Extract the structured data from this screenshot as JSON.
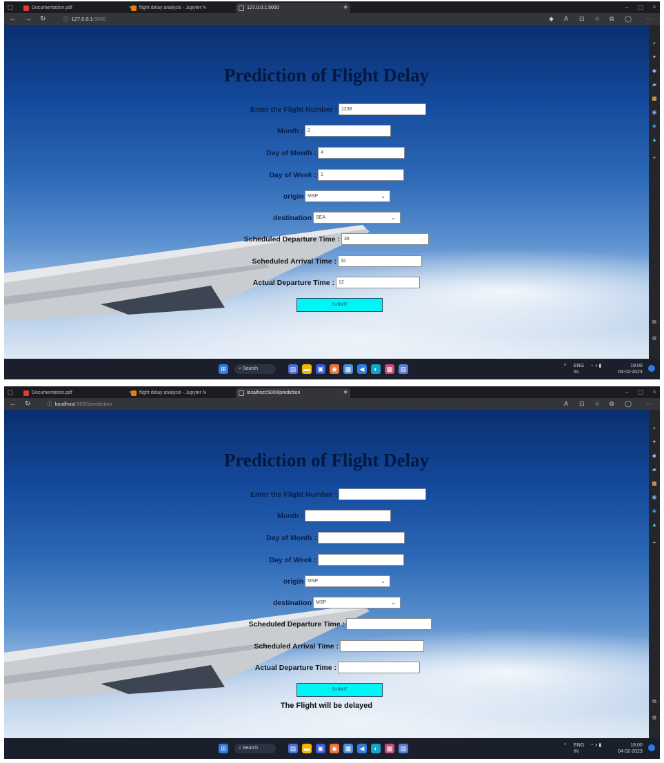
{
  "shot1": {
    "tabs": [
      {
        "title": "Documentation.pdf"
      },
      {
        "title": "flight delay analysis - Jupyter N"
      },
      {
        "title": "127.0.0.1:5000"
      }
    ],
    "url": {
      "host": "127.0.0.1",
      "path": ":5000"
    },
    "page": {
      "title": "Prediction of Flight Delay",
      "labels": {
        "flight_number": "Enter the Flight Number :",
        "month": "Month :",
        "day_of_month": "Day of Month :",
        "day_of_week": "Day of Week :",
        "origin": "origin",
        "destination": "destination",
        "sched_dep": "Scheduled Departure Time :",
        "sched_arr": "Scheduled Arrival Time :",
        "actual_dep": "Actual Departure Time :"
      },
      "values": {
        "flight_number": "1238",
        "month": "2",
        "day_of_month": "4",
        "day_of_week": "1",
        "origin": "MSP",
        "destination": "SEA",
        "sched_dep": "36",
        "sched_arr": "32",
        "actual_dep": "12"
      },
      "submit_label": "SUBMIT"
    },
    "taskbar": {
      "search": "Search",
      "lang": "ENG",
      "lang2": "IN",
      "time": "18:00",
      "date": "04-02-2023"
    }
  },
  "shot2": {
    "tabs": [
      {
        "title": "Documentation.pdf"
      },
      {
        "title": "flight delay analysis - Jupyter N"
      },
      {
        "title": "localhost:5000/prediction"
      }
    ],
    "url": {
      "host": "localhost",
      "path": ":5000/prediction"
    },
    "page": {
      "title": "Prediction of Flight Delay",
      "labels": {
        "flight_number": "Enter the Flight Number :",
        "month": "Month :",
        "day_of_month": "Day of Month :",
        "day_of_week": "Day of Week :",
        "origin": "origin",
        "destination": "destination",
        "sched_dep": "Scheduled Departure Time :",
        "sched_arr": "Scheduled Arrival Time :",
        "actual_dep": "Actual Departure Time :"
      },
      "values": {
        "origin": "MSP",
        "destination": "MSP"
      },
      "submit_label": "SUBMIT",
      "result": "The Flight will be delayed"
    },
    "taskbar": {
      "search": "Search",
      "lang": "ENG",
      "lang2": "IN",
      "time": "18:00",
      "date": "04-02-2023"
    }
  }
}
